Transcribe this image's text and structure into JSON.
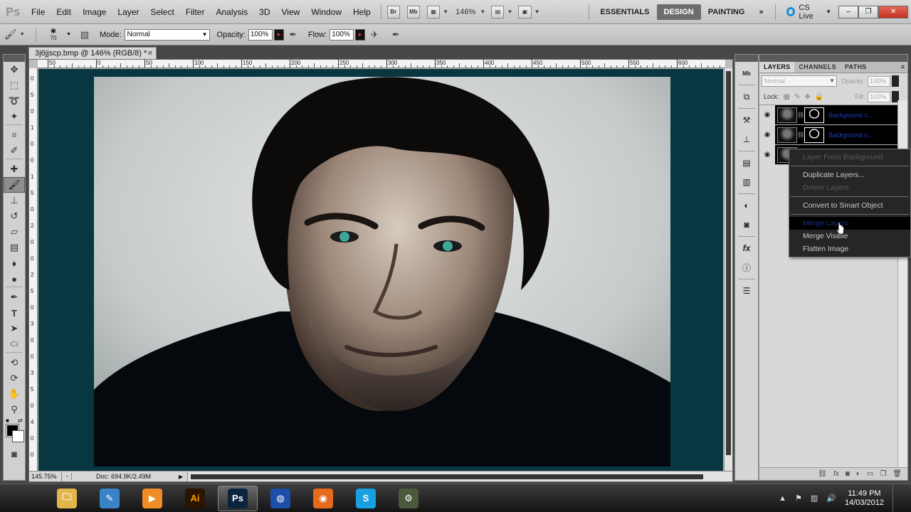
{
  "app": {
    "logo": "Ps",
    "menus": [
      "File",
      "Edit",
      "Image",
      "Layer",
      "Select",
      "Filter",
      "Analysis",
      "3D",
      "View",
      "Window",
      "Help"
    ],
    "bridge_label": "Br",
    "minibridge_label": "Mb",
    "zoom_level": "146%",
    "workspaces": [
      "ESSENTIALS",
      "DESIGN",
      "PAINTING"
    ],
    "active_workspace": "DESIGN",
    "more_workspaces": "»",
    "cs_live": "CS Live",
    "window_minimize": "–",
    "window_restore": "❐",
    "window_close": "✕"
  },
  "options": {
    "brush_size": "70",
    "mode_label": "Mode:",
    "mode_value": "Normal",
    "opacity_label": "Opacity:",
    "opacity_value": "100%",
    "flow_label": "Flow:",
    "flow_value": "100%"
  },
  "document": {
    "tab_title": "3j6jjscp.bmp @ 146% (RGB/8) *",
    "tab_close": "✕",
    "ruler_top": [
      "50",
      "0",
      "50",
      "100",
      "150",
      "200",
      "250",
      "300",
      "350",
      "400",
      "450",
      "500",
      "550",
      "600"
    ],
    "ruler_left": [
      "0",
      "5",
      "0",
      "1",
      "0",
      "0",
      "1",
      "5",
      "0",
      "2",
      "0",
      "0",
      "2",
      "5",
      "0",
      "3",
      "0",
      "0",
      "3",
      "5",
      "0",
      "4",
      "0",
      "0"
    ],
    "zoom": "145.75%",
    "doc_info": "Doc: 694.9K/2.49M",
    "play_glyph": "▶"
  },
  "layers_panel": {
    "tabs": [
      "LAYERS",
      "CHANNELS",
      "PATHS"
    ],
    "active_tab": "LAYERS",
    "menu_glyph": "≡",
    "blend_mode": "Normal",
    "opacity_label": "Opacity:",
    "opacity_value": "100%",
    "lock_label": "Lock:",
    "fill_label": "Fill:",
    "fill_value": "100%",
    "layers": [
      {
        "name": "Background c...",
        "has_mask": true
      },
      {
        "name": "Background c...",
        "has_mask": true
      },
      {
        "name": "",
        "has_mask": false
      }
    ]
  },
  "context_menu": {
    "items": [
      {
        "label": "Layer From Background",
        "state": "disabled"
      },
      {
        "separator": true
      },
      {
        "label": "Duplicate Layers...",
        "state": "enabled"
      },
      {
        "label": "Delete Layers",
        "state": "disabled"
      },
      {
        "separator": true
      },
      {
        "label": "Convert to Smart Object",
        "state": "enabled"
      },
      {
        "separator": true
      },
      {
        "label": "Merge Layers",
        "state": "hover"
      },
      {
        "label": "Merge Visible",
        "state": "enabled"
      },
      {
        "label": "Flatten Image",
        "state": "enabled"
      }
    ]
  },
  "taskbar": {
    "apps": [
      {
        "name": "explorer-icon",
        "glyph": "🗀",
        "bg": "#e4b54a"
      },
      {
        "name": "vector-editor-icon",
        "glyph": "✎",
        "bg": "#3a83c9"
      },
      {
        "name": "media-player-icon",
        "glyph": "▶",
        "bg": "#f08c25"
      },
      {
        "name": "illustrator-icon",
        "glyph": "Ai",
        "bg": "#2b1400"
      },
      {
        "name": "photoshop-icon",
        "glyph": "Ps",
        "bg": "#0b2540"
      },
      {
        "name": "globe-icon",
        "glyph": "◍",
        "bg": "#1e4fa8"
      },
      {
        "name": "firefox-icon",
        "glyph": "◉",
        "bg": "#e56a1c"
      },
      {
        "name": "skype-icon",
        "glyph": "S",
        "bg": "#18a0e0"
      },
      {
        "name": "app-icon",
        "glyph": "⚙",
        "bg": "#4a5a3a"
      }
    ],
    "active_app": "photoshop-icon",
    "time": "11:49 PM",
    "date": "14/03/2012"
  },
  "colors": {
    "canvas_bg": "#083641",
    "ui_gray": "#d0d0d0",
    "selection_link": "#1a3fbf",
    "accent_blue": "#1b8fd4"
  }
}
